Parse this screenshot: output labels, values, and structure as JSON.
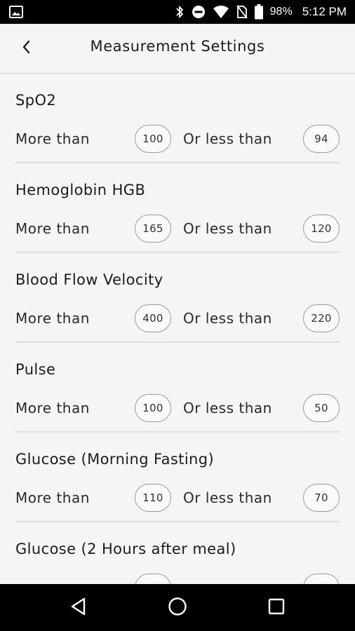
{
  "status_bar": {
    "battery_percent": "98%",
    "time": "5:12 PM",
    "icons": [
      "gallery-icon",
      "bluetooth-icon",
      "do-not-disturb-icon",
      "wifi-icon",
      "no-sim-icon",
      "battery-icon"
    ]
  },
  "header": {
    "title": "Measurement Settings",
    "back_icon": "chevron-left-icon"
  },
  "sections": [
    {
      "title": "SpO2",
      "more_label": "More than",
      "more_value": "100",
      "less_label": "Or less than",
      "less_value": "94"
    },
    {
      "title": "Hemoglobin HGB",
      "more_label": "More than",
      "more_value": "165",
      "less_label": "Or less than",
      "less_value": "120"
    },
    {
      "title": "Blood Flow Velocity",
      "more_label": "More than",
      "more_value": "400",
      "less_label": "Or less than",
      "less_value": "220"
    },
    {
      "title": "Pulse",
      "more_label": "More than",
      "more_value": "100",
      "less_label": "Or less than",
      "less_value": "50"
    },
    {
      "title": "Glucose (Morning Fasting)",
      "more_label": "More than",
      "more_value": "110",
      "less_label": "Or less than",
      "less_value": "70"
    },
    {
      "title": "Glucose (2 Hours after meal)"
    }
  ],
  "nav_bar": {
    "icons": [
      "back-triangle-icon",
      "home-circle-icon",
      "recents-square-icon"
    ]
  }
}
